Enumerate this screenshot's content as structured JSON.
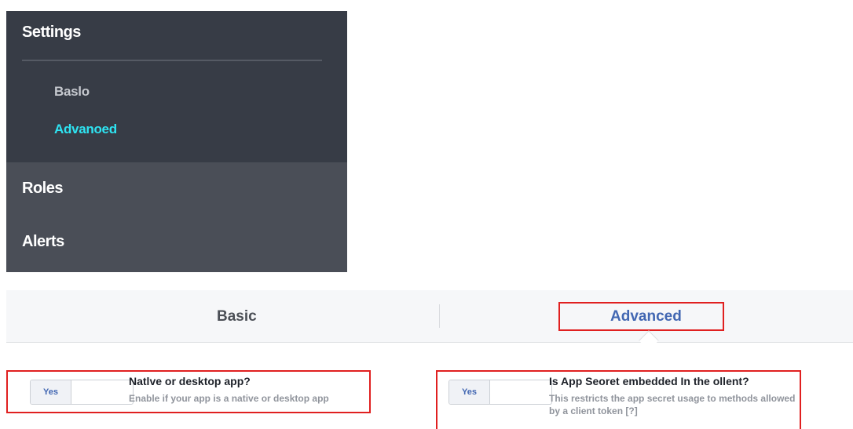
{
  "sidebar": {
    "title": "Settings",
    "sub_items": [
      {
        "label": "Baslo"
      },
      {
        "label": "Advanoed"
      }
    ],
    "main_items": [
      {
        "label": "Roles"
      },
      {
        "label": "Alerts"
      }
    ],
    "active_color": "#2ee4f2",
    "background_top": "#373c46",
    "background_bottom": "#4a4e57"
  },
  "tabs": [
    {
      "label": "Basic",
      "active": false
    },
    {
      "label": "Advanced",
      "active": true
    }
  ],
  "settings": [
    {
      "toggle_label": "Yes",
      "title": "Natlve or desktop app?",
      "description": "Enable if your app is a native or desktop app"
    },
    {
      "toggle_label": "Yes",
      "title": "Is App Seoret embedded In the ollent?",
      "description": "This restricts the app secret usage to methods allowed by a client token",
      "help": "[?]"
    }
  ],
  "colors": {
    "highlight_border": "#e02020",
    "link_blue": "#4267b2"
  }
}
